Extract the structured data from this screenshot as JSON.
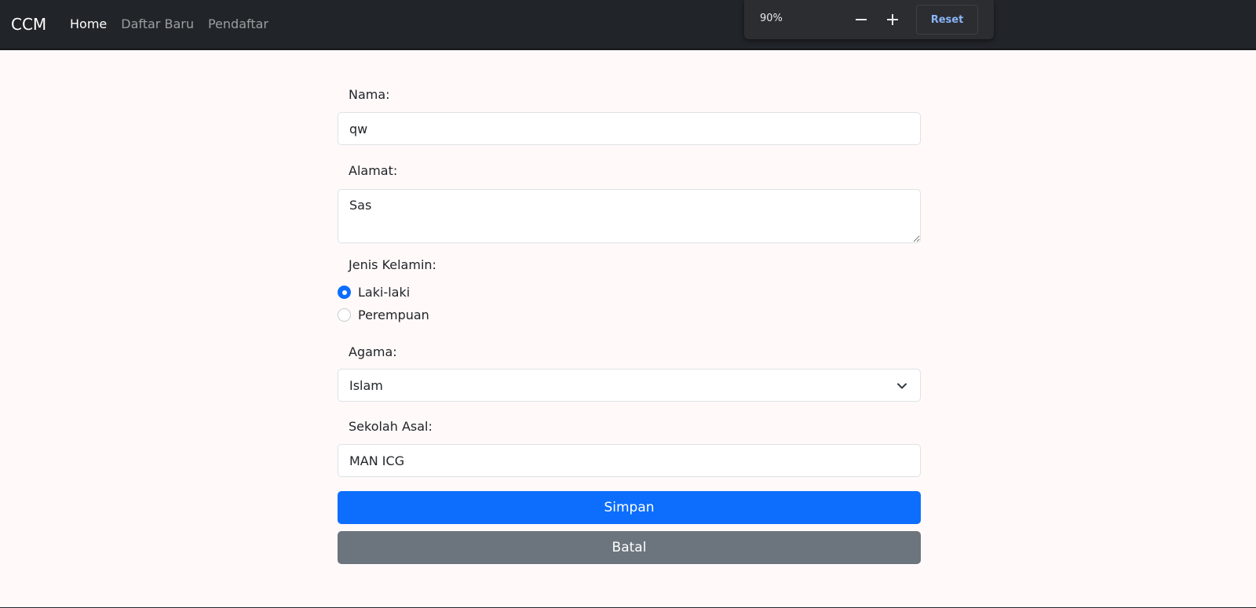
{
  "navbar": {
    "brand": "CCM",
    "links": [
      {
        "label": "Home",
        "active": true
      },
      {
        "label": "Daftar Baru",
        "active": false
      },
      {
        "label": "Pendaftar",
        "active": false
      }
    ]
  },
  "zoom": {
    "level": "90%",
    "reset_label": "Reset"
  },
  "form": {
    "nama": {
      "label": "Nama:",
      "value": "qw"
    },
    "alamat": {
      "label": "Alamat:",
      "value": "Sas"
    },
    "jenis_kelamin": {
      "label": "Jenis Kelamin:",
      "options": [
        {
          "label": "Laki-laki",
          "checked": true
        },
        {
          "label": "Perempuan",
          "checked": false
        }
      ]
    },
    "agama": {
      "label": "Agama:",
      "value": "Islam"
    },
    "sekolah_asal": {
      "label": "Sekolah Asal:",
      "value": "MAN ICG"
    },
    "submit_label": "Simpan",
    "cancel_label": "Batal"
  },
  "colors": {
    "navbar_bg": "#212529",
    "page_bg": "#fff9f9",
    "primary": "#0d6efd",
    "secondary": "#6c757d",
    "zoom_accent": "#8ab4f8"
  }
}
